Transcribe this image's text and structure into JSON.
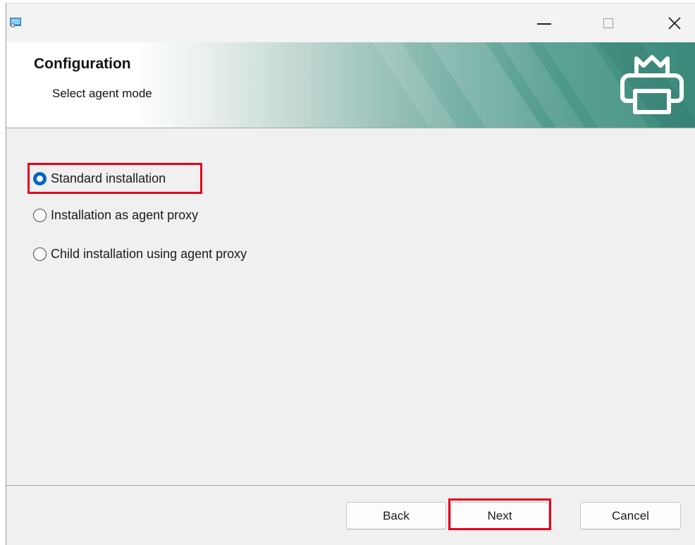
{
  "window": {
    "icon": "installer-window-icon",
    "controls": {
      "minimize_icon": "minimize-icon",
      "maximize_icon": "maximize-icon",
      "close_icon": "close-icon",
      "close_glyph": "✕"
    }
  },
  "banner": {
    "title": "Configuration",
    "subtitle": "Select agent mode",
    "icon": "printer-icon",
    "accent_color": "#3a8a7b"
  },
  "agent_mode": {
    "options": [
      {
        "label": "Standard installation",
        "selected": true
      },
      {
        "label": "Installation as agent proxy",
        "selected": false
      },
      {
        "label": "Child installation using agent proxy",
        "selected": false
      }
    ]
  },
  "footer": {
    "back_label": "Back",
    "next_label": "Next",
    "cancel_label": "Cancel"
  },
  "colors": {
    "radio_selected": "#0067c0",
    "highlight": "#e3001b"
  }
}
